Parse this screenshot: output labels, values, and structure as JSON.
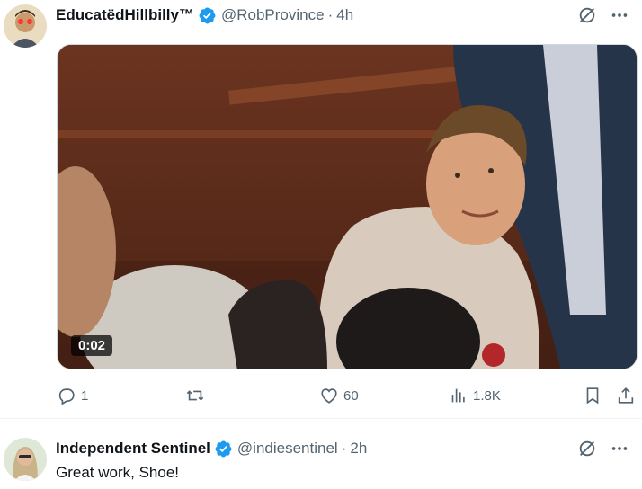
{
  "tweets": [
    {
      "author_name": "EducatëdHillbilly™",
      "handle": "@RobProvince",
      "separator": "·",
      "time": "4h",
      "avatar_icon": "user-avatar-red-laser-eyes",
      "video": {
        "duration": "0:02"
      },
      "actions": {
        "replies": "1",
        "reposts": "",
        "likes": "60",
        "views": "1.8K"
      }
    },
    {
      "author_name": "Independent Sentinel",
      "handle": "@indiesentinel",
      "separator": "·",
      "time": "2h",
      "avatar_icon": "user-avatar-woman",
      "text": "Great work, Shoe!"
    }
  ],
  "colors": {
    "verified": "#1d9bf0",
    "secondary_text": "#536471",
    "primary_text": "#0f1419"
  }
}
